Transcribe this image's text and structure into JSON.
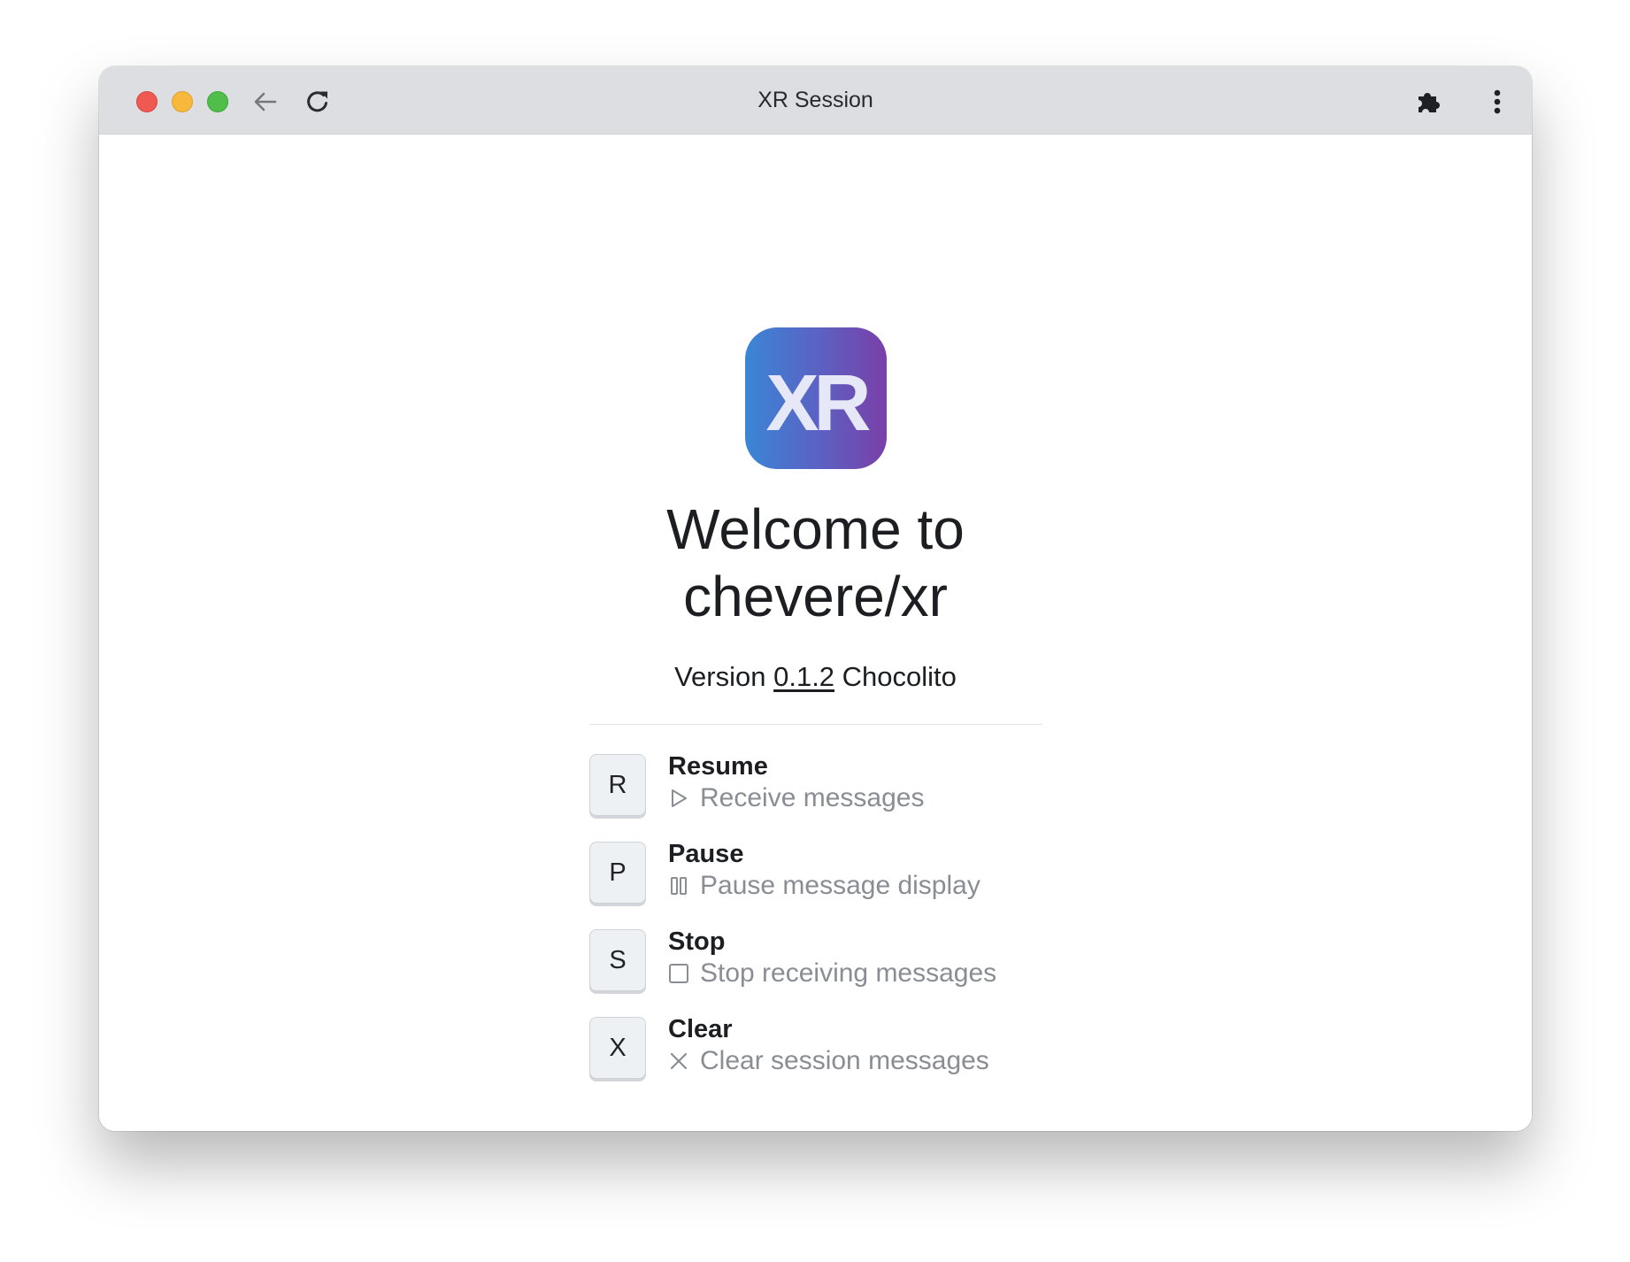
{
  "window": {
    "title": "XR Session"
  },
  "toolbar": {
    "icons": [
      "back-arrow-icon",
      "reload-icon",
      "extensions-puzzle-icon",
      "more-vert-icon"
    ]
  },
  "logo": {
    "text": "XR",
    "gradient": [
      "#3a86d6",
      "#7a3fa8"
    ]
  },
  "welcome": {
    "line1": "Welcome to",
    "line2": "chevere/xr"
  },
  "version": {
    "prefix": "Version",
    "number": "0.1.2",
    "codename": "Chocolito"
  },
  "commands": [
    {
      "key": "R",
      "title": "Resume",
      "description": "Receive messages",
      "icon": "play-outline-icon"
    },
    {
      "key": "P",
      "title": "Pause",
      "description": "Pause message display",
      "icon": "pause-outline-icon"
    },
    {
      "key": "S",
      "title": "Stop",
      "description": "Stop receiving messages",
      "icon": "stop-square-icon"
    },
    {
      "key": "X",
      "title": "Clear",
      "description": "Clear session messages",
      "icon": "x-close-icon"
    }
  ],
  "colors": {
    "titlebar": "#dcdee2",
    "close": "#ee5a52",
    "minimize": "#f6b93b",
    "maximize": "#4fbf4a",
    "description_text": "#8a8d93"
  }
}
